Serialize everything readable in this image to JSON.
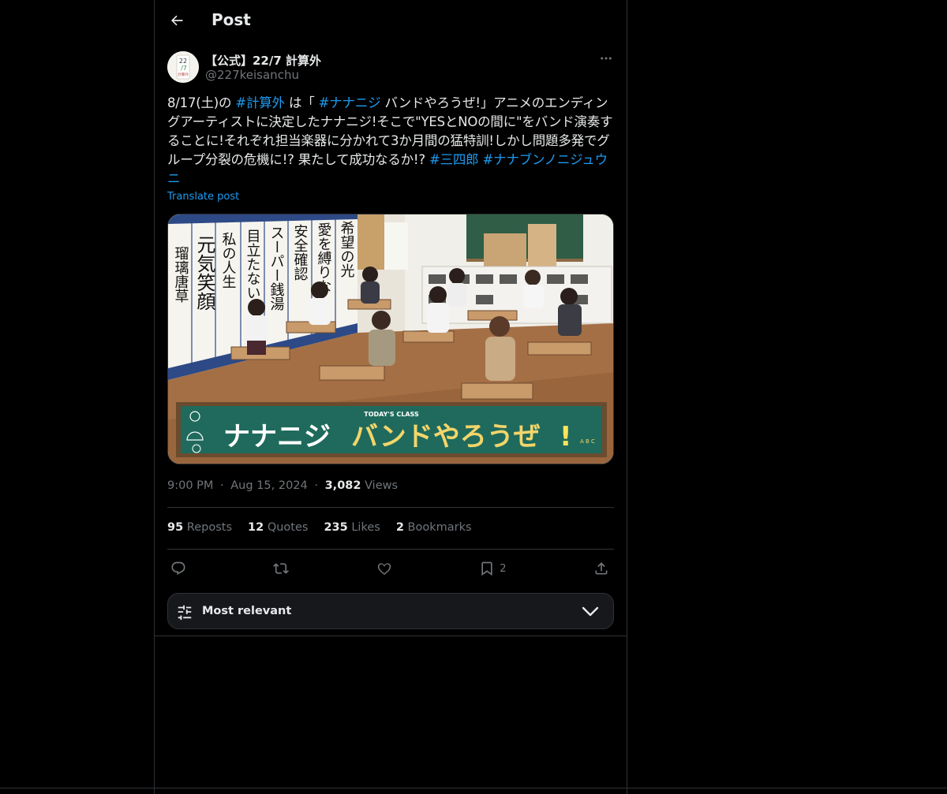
{
  "header": {
    "title": "Post"
  },
  "author": {
    "display_name": "【公式】22/7 計算外",
    "handle": "@227keisanchu",
    "avatar_text_top": "22",
    "avatar_text_mid": "/7",
    "avatar_text_bottom": "計算外"
  },
  "post": {
    "segments": [
      {
        "text": "8/17(土)の ",
        "hashtag": false
      },
      {
        "text": "#計算外",
        "hashtag": true
      },
      {
        "text": " は「 ",
        "hashtag": false
      },
      {
        "text": "#ナナニジ",
        "hashtag": true
      },
      {
        "text": " バンドやろうぜ!」アニメのエンディングアーティストに決定したナナニジ!そこで\"YESとNOの間に\"をバンド演奏することに!それぞれ担当楽器に分かれて3か月間の猛特訓!しかし問題多発でグループ分裂の危機に!? 果たして成功なるか!? ",
        "hashtag": false
      },
      {
        "text": "#三四郎",
        "hashtag": true
      },
      {
        "text": " ",
        "hashtag": false
      },
      {
        "text": "#ナナブンノニジュウニ",
        "hashtag": true
      }
    ],
    "translate_label": "Translate post",
    "media": {
      "banner_small": "TODAY'S CLASS",
      "banner_part1": "ナナニジ",
      "banner_part2": "バンドやろうぜ",
      "banner_part3": "!",
      "banner_abc": "A B C",
      "scroll_texts": [
        "瑠璃唐草",
        "元気笑顔",
        "私の人生",
        "目立たない",
        "スーパー銭湯",
        "安全確認",
        "愛を縛りな",
        "希望の光"
      ]
    },
    "time": "9:00 PM",
    "date": "Aug 15, 2024",
    "separator": "·",
    "views_count": "3,082",
    "views_label": "Views"
  },
  "stats": {
    "reposts_count": "95",
    "reposts_label": "Reposts",
    "quotes_count": "12",
    "quotes_label": "Quotes",
    "likes_count": "235",
    "likes_label": "Likes",
    "bookmarks_count": "2",
    "bookmarks_label": "Bookmarks"
  },
  "actions": {
    "bookmark_count": "2"
  },
  "sort": {
    "label": "Most relevant"
  },
  "colors": {
    "accent": "#1d9bf0",
    "muted": "#71767b",
    "text": "#e7e9ea",
    "border": "#2f3336",
    "background": "#000000"
  },
  "icons": [
    "back-arrow-icon",
    "more-icon",
    "reply-icon",
    "repost-icon",
    "like-icon",
    "bookmark-icon",
    "share-icon",
    "sliders-icon",
    "chevron-down-icon"
  ]
}
